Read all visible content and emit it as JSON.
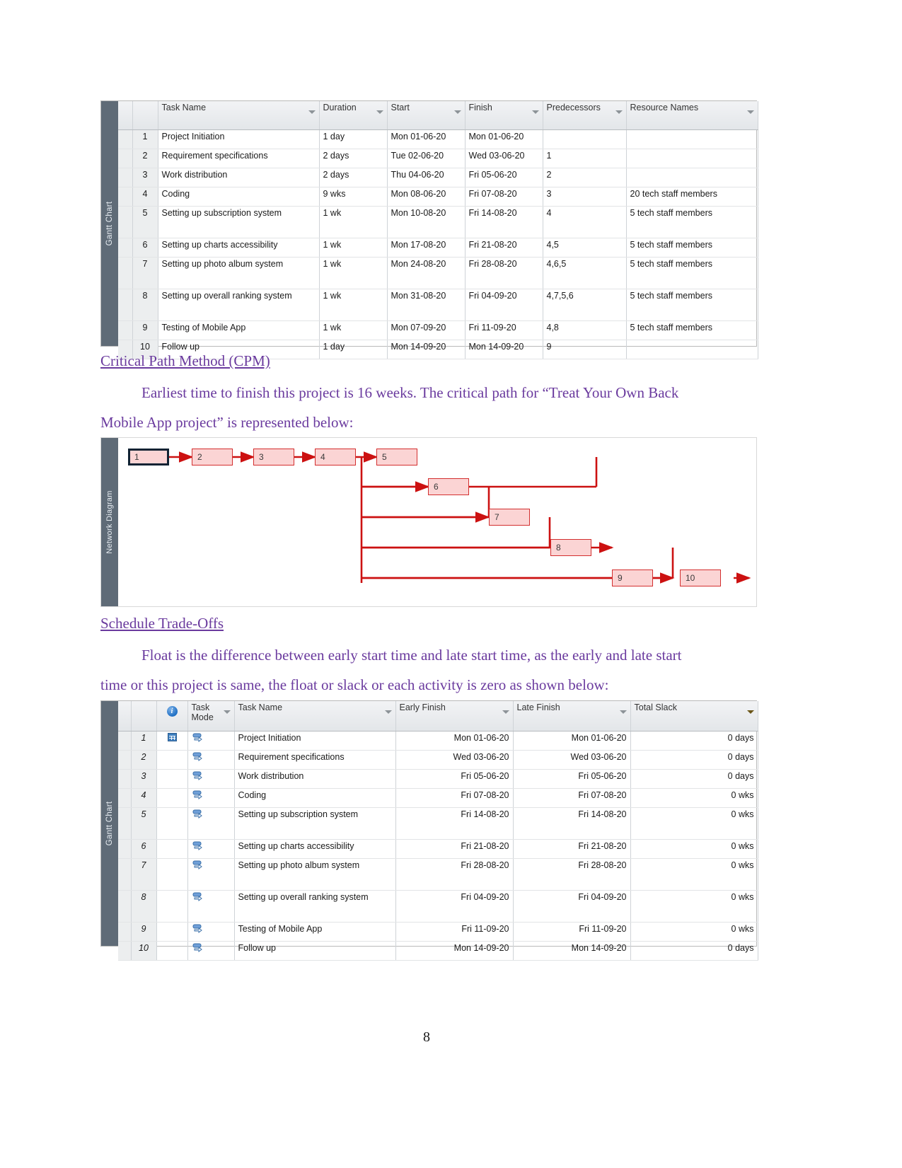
{
  "colors": {
    "heading_purple": "#6a3a9e",
    "diagram_red": "#d32f2f",
    "node_fill": "#fbd4d4",
    "slack_header": "#f7cf53",
    "strip_gray": "#5f6b77"
  },
  "gantt_table": {
    "strip_label": "Gantt Chart",
    "columns": [
      "Task Name",
      "Duration",
      "Start",
      "Finish",
      "Predecessors",
      "Resource Names"
    ],
    "rows": [
      {
        "num": "1",
        "task": "Project Initiation",
        "duration": "1 day",
        "start": "Mon 01-06-20",
        "finish": "Mon 01-06-20",
        "pred": "",
        "res": ""
      },
      {
        "num": "2",
        "task": "Requirement specifications",
        "duration": "2 days",
        "start": "Tue 02-06-20",
        "finish": "Wed 03-06-20",
        "pred": "1",
        "res": ""
      },
      {
        "num": "3",
        "task": "Work distribution",
        "duration": "2 days",
        "start": "Thu 04-06-20",
        "finish": "Fri 05-06-20",
        "pred": "2",
        "res": ""
      },
      {
        "num": "4",
        "task": "Coding",
        "duration": "9 wks",
        "start": "Mon 08-06-20",
        "finish": "Fri 07-08-20",
        "pred": "3",
        "res": "20 tech staff members"
      },
      {
        "num": "5",
        "task": "Setting up subscription system",
        "duration": "1 wk",
        "start": "Mon 10-08-20",
        "finish": "Fri 14-08-20",
        "pred": "4",
        "res": "5 tech staff members"
      },
      {
        "num": "6",
        "task": "Setting up charts accessibility",
        "duration": "1 wk",
        "start": "Mon 17-08-20",
        "finish": "Fri 21-08-20",
        "pred": "4,5",
        "res": "5 tech staff members"
      },
      {
        "num": "7",
        "task": "Setting up photo album system",
        "duration": "1 wk",
        "start": "Mon 24-08-20",
        "finish": "Fri 28-08-20",
        "pred": "4,6,5",
        "res": "5 tech staff members"
      },
      {
        "num": "8",
        "task": "Setting up overall ranking system",
        "duration": "1 wk",
        "start": "Mon 31-08-20",
        "finish": "Fri 04-09-20",
        "pred": "4,7,5,6",
        "res": "5 tech staff members"
      },
      {
        "num": "9",
        "task": "Testing of Mobile App",
        "duration": "1 wk",
        "start": "Mon 07-09-20",
        "finish": "Fri 11-09-20",
        "pred": "4,8",
        "res": "5 tech staff members"
      },
      {
        "num": "10",
        "task": "Follow up",
        "duration": "1 day",
        "start": "Mon 14-09-20",
        "finish": "Mon 14-09-20",
        "pred": "9",
        "res": ""
      }
    ]
  },
  "section_cpm": {
    "heading": "Critical Path Method (CPM)",
    "paragraph_line1": "Earliest time to finish this project is 16 weeks. The critical path for “Treat Your Own Back",
    "paragraph_line2": "Mobile App project” is represented below:"
  },
  "network_diagram": {
    "strip_label": "Network Diagram",
    "nodes": [
      {
        "label": "1"
      },
      {
        "label": "2"
      },
      {
        "label": "3"
      },
      {
        "label": "4"
      },
      {
        "label": "5"
      },
      {
        "label": "6"
      },
      {
        "label": "7"
      },
      {
        "label": "8"
      },
      {
        "label": "9"
      },
      {
        "label": "10"
      }
    ]
  },
  "section_tradeoffs": {
    "heading": "Schedule Trade-Offs",
    "paragraph_line1": "Float is the difference between early start time and late start time, as the early and late start",
    "paragraph_line2": "time or this project is same, the float or slack or each activity is zero as shown below:"
  },
  "slack_table": {
    "strip_label": "Gantt Chart",
    "columns": {
      "info": "information-icon",
      "task_mode": "Task Mode",
      "task_name": "Task Name",
      "early_finish": "Early Finish",
      "late_finish": "Late Finish",
      "total_slack": "Total Slack"
    },
    "rows": [
      {
        "num": "1",
        "indicator": "calendar-icon",
        "mode": "auto-schedule-icon",
        "task": "Project Initiation",
        "early": "Mon 01-06-20",
        "late": "Mon 01-06-20",
        "slack": "0 days"
      },
      {
        "num": "2",
        "indicator": "",
        "mode": "auto-schedule-icon",
        "task": "Requirement specifications",
        "early": "Wed 03-06-20",
        "late": "Wed 03-06-20",
        "slack": "0 days"
      },
      {
        "num": "3",
        "indicator": "",
        "mode": "auto-schedule-icon",
        "task": "Work distribution",
        "early": "Fri 05-06-20",
        "late": "Fri 05-06-20",
        "slack": "0 days"
      },
      {
        "num": "4",
        "indicator": "",
        "mode": "auto-schedule-icon",
        "task": "Coding",
        "early": "Fri 07-08-20",
        "late": "Fri 07-08-20",
        "slack": "0 wks"
      },
      {
        "num": "5",
        "indicator": "",
        "mode": "auto-schedule-icon",
        "task": "Setting up subscription system",
        "early": "Fri 14-08-20",
        "late": "Fri 14-08-20",
        "slack": "0 wks"
      },
      {
        "num": "6",
        "indicator": "",
        "mode": "auto-schedule-icon",
        "task": "Setting up charts accessibility",
        "early": "Fri 21-08-20",
        "late": "Fri 21-08-20",
        "slack": "0 wks"
      },
      {
        "num": "7",
        "indicator": "",
        "mode": "auto-schedule-icon",
        "task": "Setting up photo album system",
        "early": "Fri 28-08-20",
        "late": "Fri 28-08-20",
        "slack": "0 wks"
      },
      {
        "num": "8",
        "indicator": "",
        "mode": "auto-schedule-icon",
        "task": "Setting up overall ranking system",
        "early": "Fri 04-09-20",
        "late": "Fri 04-09-20",
        "slack": "0 wks"
      },
      {
        "num": "9",
        "indicator": "",
        "mode": "auto-schedule-icon",
        "task": "Testing of Mobile App",
        "early": "Fri 11-09-20",
        "late": "Fri 11-09-20",
        "slack": "0 wks"
      },
      {
        "num": "10",
        "indicator": "",
        "mode": "auto-schedule-icon",
        "task": "Follow up",
        "early": "Mon 14-09-20",
        "late": "Mon 14-09-20",
        "slack": "0 days"
      }
    ]
  },
  "footer": {
    "page_number": "8"
  }
}
